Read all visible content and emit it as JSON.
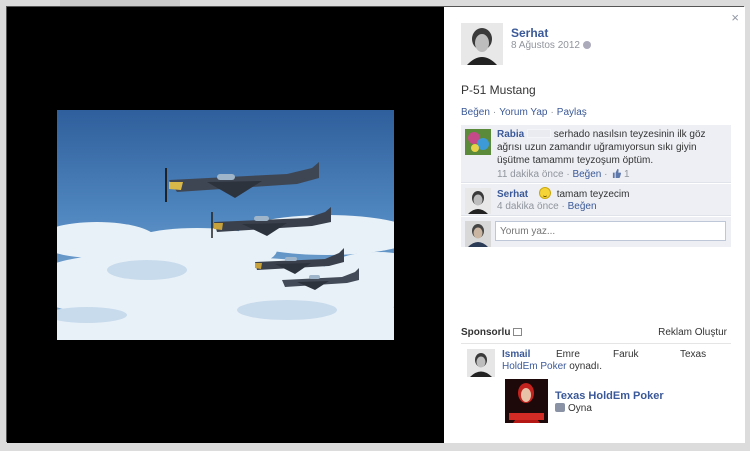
{
  "post": {
    "owner_name": "Serhat",
    "date": "8 Ağustos 2012",
    "caption": "P-51 Mustang",
    "actions": {
      "like": "Beğen",
      "comment": "Yorum Yap",
      "share": "Paylaş",
      "sep": "·"
    }
  },
  "close_label": "×",
  "comments": [
    {
      "name": "Rabia",
      "text": "serhado nasılsın teyzesinin ilk göz ağrısı uzun zamandır uğramıyorsun sıkı giyin üşütme tamammı teyzoşum öptüm.",
      "time": "11 dakika önce",
      "like": "Beğen",
      "like_count": "1"
    },
    {
      "name": "Serhat",
      "text": "tamam teyzecim",
      "time": "4 dakika önce",
      "like": "Beğen"
    }
  ],
  "reply": {
    "placeholder": "Yorum yaz..."
  },
  "sponsored": {
    "title": "Sponsorlu",
    "create_ad": "Reklam Oluştur",
    "names": [
      "Ismail",
      "Emre",
      "Faruk",
      "Texas"
    ],
    "played_game": "HoldEm Poker",
    "played_suffix": "oynadı.",
    "game_title": "Texas HoldEm Poker",
    "play_label": "Oyna"
  },
  "colors": {
    "link": "#3b5998",
    "meta": "#90949c",
    "comment_bg": "#edeff4"
  }
}
